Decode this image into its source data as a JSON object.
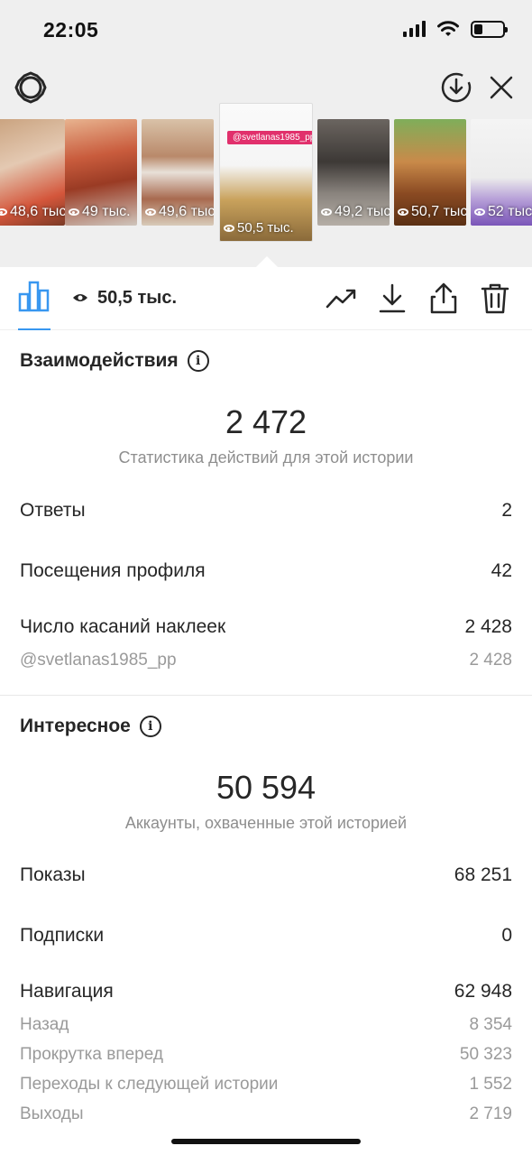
{
  "status_bar": {
    "time": "22:05"
  },
  "stories": [
    {
      "views": "48,6 тыс.",
      "tag": ""
    },
    {
      "views": "49 тыс.",
      "tag": ""
    },
    {
      "views": "49,6 тыс.",
      "tag": ""
    },
    {
      "views": "50,5 тыс.",
      "tag": "@svetlanas1985_pp"
    },
    {
      "views": "49,2 тыс.",
      "tag": ""
    },
    {
      "views": "50,7 тыс.",
      "tag": ""
    },
    {
      "views": "52 тыс.",
      "tag": ""
    }
  ],
  "action_bar": {
    "views_count": "50,5 тыс."
  },
  "interactions": {
    "title": "Взаимодействия",
    "total": "2 472",
    "caption": "Статистика действий для этой истории",
    "rows": [
      {
        "label": "Ответы",
        "value": "2"
      },
      {
        "label": "Посещения профиля",
        "value": "42"
      },
      {
        "label": "Число касаний наклеек",
        "value": "2 428"
      }
    ],
    "sub_rows": [
      {
        "label": "@svetlanas1985_pp",
        "value": "2 428"
      }
    ]
  },
  "discovery": {
    "title": "Интересное",
    "total": "50 594",
    "caption": "Аккаунты, охваченные этой историей",
    "rows": [
      {
        "label": "Показы",
        "value": "68 251"
      },
      {
        "label": "Подписки",
        "value": "0"
      },
      {
        "label": "Навигация",
        "value": "62 948"
      }
    ],
    "sub_rows": [
      {
        "label": "Назад",
        "value": "8 354"
      },
      {
        "label": "Прокрутка вперед",
        "value": "50 323"
      },
      {
        "label": "Переходы к следующей истории",
        "value": "1 552"
      },
      {
        "label": "Выходы",
        "value": "2 719"
      }
    ]
  },
  "colors": {
    "accent": "#3897f0",
    "text": "#262626",
    "muted": "#8e8e8e",
    "tag": "#e1306c"
  }
}
